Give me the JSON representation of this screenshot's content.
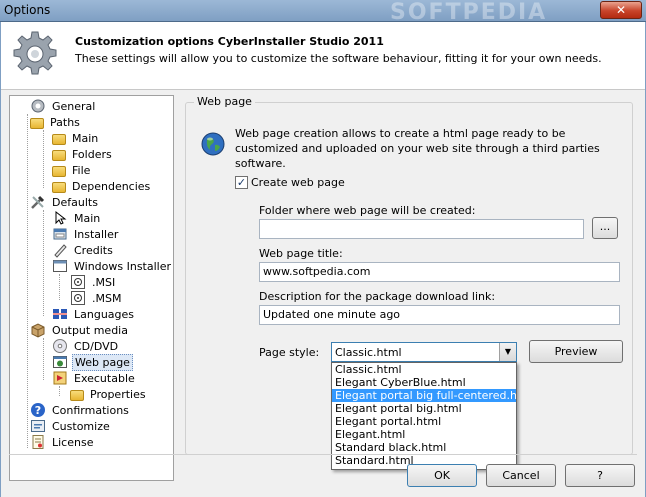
{
  "window": {
    "title": "Options",
    "close_label": "✕",
    "watermark": "SOFTPEDIA"
  },
  "header": {
    "title": "Customization options CyberInstaller Studio 2011",
    "subtitle": "These settings will allow you to customize the software behaviour, fitting it for your own needs."
  },
  "tree": {
    "items": [
      {
        "label": "General",
        "icon": "gear-icon"
      },
      {
        "label": "Paths",
        "icon": "folder-icon"
      },
      {
        "label": "Main",
        "icon": "folder-icon"
      },
      {
        "label": "Folders",
        "icon": "folder-icon"
      },
      {
        "label": "File",
        "icon": "folder-icon"
      },
      {
        "label": "Dependencies",
        "icon": "folder-icon"
      },
      {
        "label": "Defaults",
        "icon": "tools-icon"
      },
      {
        "label": "Main",
        "icon": "cursor-icon"
      },
      {
        "label": "Installer",
        "icon": "installer-icon"
      },
      {
        "label": "Credits",
        "icon": "pen-icon"
      },
      {
        "label": "Windows Installer",
        "icon": "window-icon"
      },
      {
        "label": ".MSI",
        "icon": "msi-icon"
      },
      {
        "label": ".MSM",
        "icon": "msi-icon"
      },
      {
        "label": "Languages",
        "icon": "languages-icon"
      },
      {
        "label": "Output media",
        "icon": "box-icon"
      },
      {
        "label": "CD/DVD",
        "icon": "cd-icon"
      },
      {
        "label": "Web page",
        "icon": "webpage-icon"
      },
      {
        "label": "Executable",
        "icon": "executable-icon"
      },
      {
        "label": "Properties",
        "icon": "properties-icon"
      },
      {
        "label": "Confirmations",
        "icon": "help-icon"
      },
      {
        "label": "Customize",
        "icon": "customize-icon"
      },
      {
        "label": "License",
        "icon": "license-icon"
      }
    ]
  },
  "panel": {
    "group_title": "Web page",
    "description": "Web page creation allows to create a html page ready to be customized and uploaded on your web site through a third parties software.",
    "create_checkbox_label": "Create web page",
    "create_checked": true,
    "check_mark": "✓",
    "folder_label": "Folder where web page will be created:",
    "folder_value": "",
    "browse_label": "...",
    "title_label": "Web page title:",
    "title_value": "www.softpedia.com",
    "desc_label": "Description for the package download link:",
    "desc_value": "Updated one minute ago",
    "style_label": "Page style:",
    "style_value": "Classic.html",
    "style_arrow": "▼",
    "preview_label": "Preview",
    "style_options": [
      "Classic.html",
      "Elegant CyberBlue.html",
      "Elegant portal big full-centered.html",
      "Elegant portal big.html",
      "Elegant portal.html",
      "Elegant.html",
      "Standard black.html",
      "Standard.html"
    ],
    "highlighted_option": "Elegant portal big full-centered.html"
  },
  "footer": {
    "ok_label": "OK",
    "cancel_label": "Cancel",
    "help_label": "?"
  }
}
